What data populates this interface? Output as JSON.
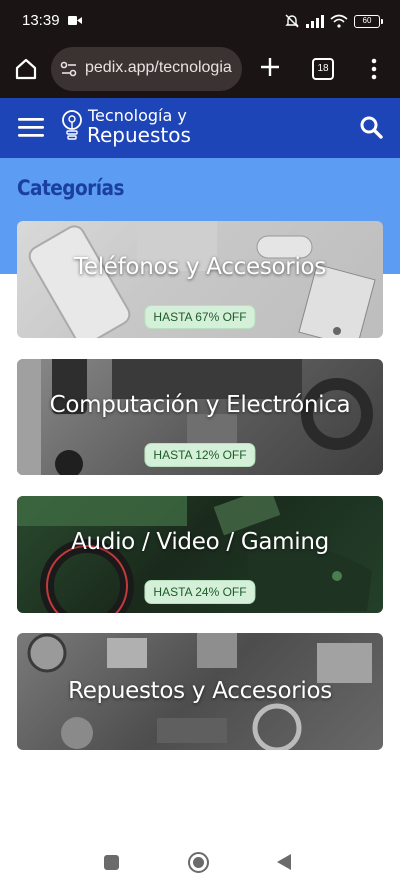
{
  "status_bar": {
    "time": "13:39",
    "battery": "60"
  },
  "browser": {
    "url": "pedix.app/tecnologia",
    "tab_count": "18"
  },
  "header": {
    "logo_line1": "Tecnología y",
    "logo_line2": "Repuestos"
  },
  "section": {
    "title": "Categorías"
  },
  "categories": [
    {
      "title": "Teléfonos y Accesorios",
      "badge": "HASTA 67% OFF"
    },
    {
      "title": "Computación y Electrónica",
      "badge": "HASTA 12% OFF"
    },
    {
      "title": "Audio / Video / Gaming",
      "badge": "HASTA 24% OFF"
    },
    {
      "title": "Repuestos y Accesorios",
      "badge": ""
    }
  ],
  "colors": {
    "header_blue": "#1e45b8",
    "band_blue": "#5c9cf2",
    "badge_green": "#d4f0d8"
  }
}
